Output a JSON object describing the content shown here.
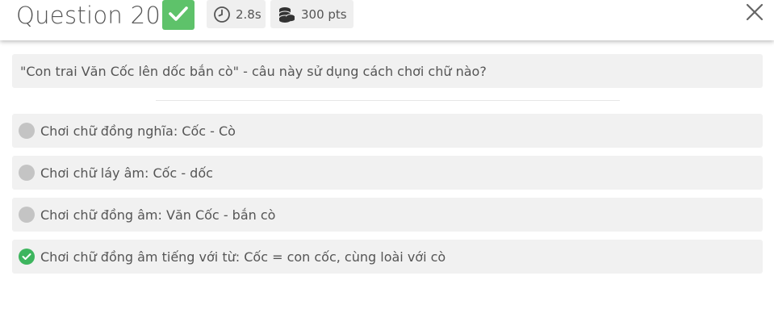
{
  "header": {
    "title": "Question 20",
    "time": "2.8s",
    "points": "300 pts",
    "status": "correct"
  },
  "question": {
    "text": "\"Con trai Văn Cốc lên dốc bắn cò\" - câu này sử dụng cách chơi chữ nào?"
  },
  "options": [
    {
      "text": "Chơi chữ đồng nghĩa: Cốc - Cò",
      "correct": false
    },
    {
      "text": "Chơi chữ láy âm: Cốc - dốc",
      "correct": false
    },
    {
      "text": "Chơi chữ đồng âm: Văn Cốc - bắn cò",
      "correct": false
    },
    {
      "text": "Chơi chữ đồng âm tiếng với từ: Cốc = con cốc, cùng loài với cò",
      "correct": true
    }
  ],
  "colors": {
    "correct": "#5ec26a",
    "neutral_dot": "#c4c4c4",
    "panel": "#f1f1f1"
  },
  "icons": {
    "status": "checkmark-icon",
    "time": "stopwatch-icon",
    "points": "coins-icon",
    "close": "close-icon"
  }
}
